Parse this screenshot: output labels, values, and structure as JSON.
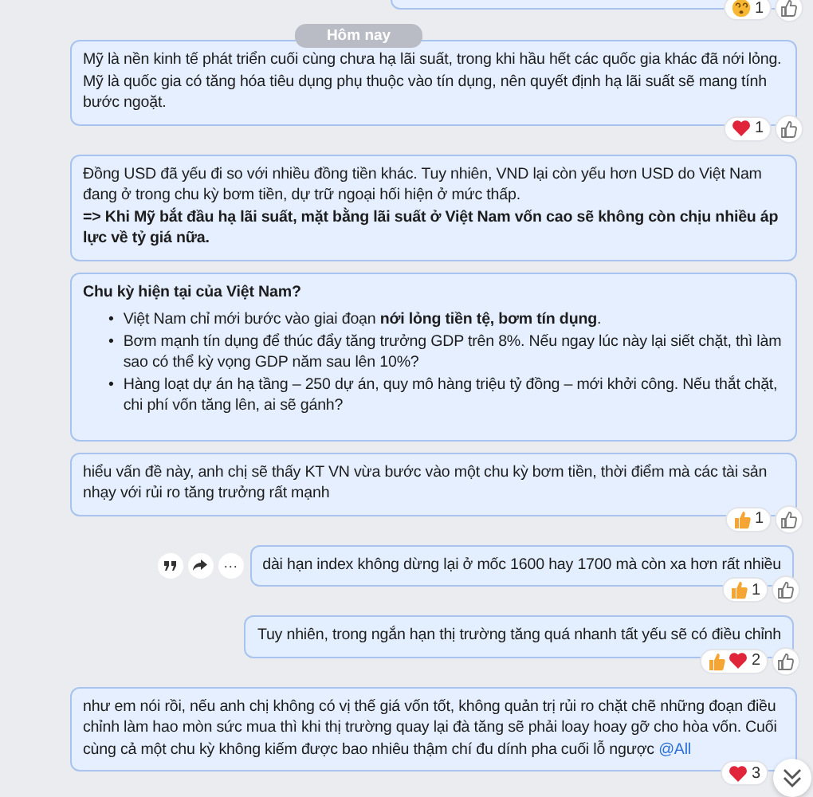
{
  "previous_message": {
    "reactions": [
      {
        "kind": "dizzy",
        "count": "1"
      }
    ],
    "like_button": true
  },
  "date_divider": "Hôm nay",
  "messages": [
    {
      "outgoing": false,
      "paragraphs": [
        "Mỹ là nền kinh tế phát triển cuối cùng chưa hạ lãi suất, trong khi hầu hết các quốc gia khác đã nới lỏng. Mỹ là quốc gia có tăng hóa tiêu dụng phụ thuộc vào tín dụng, nên quyết định hạ lãi suất sẽ mang tính bước ngoặt."
      ],
      "reactions": [
        {
          "kind": "heart"
        }
      ],
      "reaction_count": "1",
      "like_button": true
    },
    {
      "outgoing": false,
      "paragraphs": [
        "Đồng USD đã yếu đi so với nhiều đồng tiền khác. Tuy nhiên, VND lại còn yếu hơn USD do Việt Nam đang ở trong chu kỳ bơm tiền, dự trữ ngoại hối hiện ở mức thấp.",
        "**=> Khi Mỹ bắt đầu hạ lãi suất, mặt bằng lãi suất ở Việt Nam vốn cao sẽ không còn chịu nhiều áp lực về tỷ giá nữa.**"
      ]
    },
    {
      "outgoing": false,
      "heading": "Chu kỳ hiện tại của Việt Nam?",
      "bullet": "•",
      "bullets": [
        "Việt Nam chỉ mới bước vào giai đoạn **nới lỏng tiền tệ, bơm tín dụng**.",
        "Bơm mạnh tín dụng để thúc đẩy tăng trưởng GDP trên 8%. Nếu ngay lúc này lại siết chặt, thì làm sao có thể kỳ vọng GDP năm sau lên 10%?",
        "Hàng loạt dự án hạ tầng – 250 dự án, quy mô hàng triệu tỷ đồng – mới khởi công. Nếu thắt chặt, chi phí vốn tăng lên, ai sẽ gánh?"
      ]
    },
    {
      "outgoing": false,
      "paragraphs": [
        "hiểu vấn đề này, anh chị sẽ thấy KT VN vừa bước vào một chu kỳ bơm tiền, thời điểm mà các tài sản nhạy với rủi ro tăng trưởng rất mạnh"
      ],
      "reactions": [
        {
          "kind": "thumbs_up"
        }
      ],
      "reaction_count": "1",
      "like_button": true
    },
    {
      "outgoing": true,
      "show_actions": true,
      "action_more": "···",
      "paragraphs": [
        "dài hạn index không dừng lại ở mốc 1600 hay 1700 mà còn xa hơn rất nhiều"
      ],
      "reactions": [
        {
          "kind": "thumbs_up"
        }
      ],
      "reaction_count": "1",
      "like_button": true
    },
    {
      "outgoing": true,
      "paragraphs": [
        "Tuy nhiên, trong ngắn hạn thị trường tăng quá nhanh tất yếu sẽ có điều chỉnh"
      ],
      "reactions": [
        {
          "kind": "thumbs_up"
        },
        {
          "kind": "heart"
        }
      ],
      "reaction_count": "2",
      "like_button": true
    },
    {
      "outgoing": false,
      "paragraphs": [
        "như em nói rồi, nếu anh chị không có vị thế giá vốn tốt, không quản trị rủi ro chặt chẽ những đoạn điều chỉnh làm hao mòn sức mua thì khi thị trường quay lại đà tăng sẽ phải loay hoay gỡ cho hòa vốn. Cuối cùng cả một chu kỳ không kiếm được bao nhiêu thậm chí đu dính pha cuối lỗ ngược"
      ],
      "mention": "@All",
      "reactions": [
        {
          "kind": "heart"
        }
      ],
      "reaction_count": "3",
      "like_button": false
    }
  ]
}
